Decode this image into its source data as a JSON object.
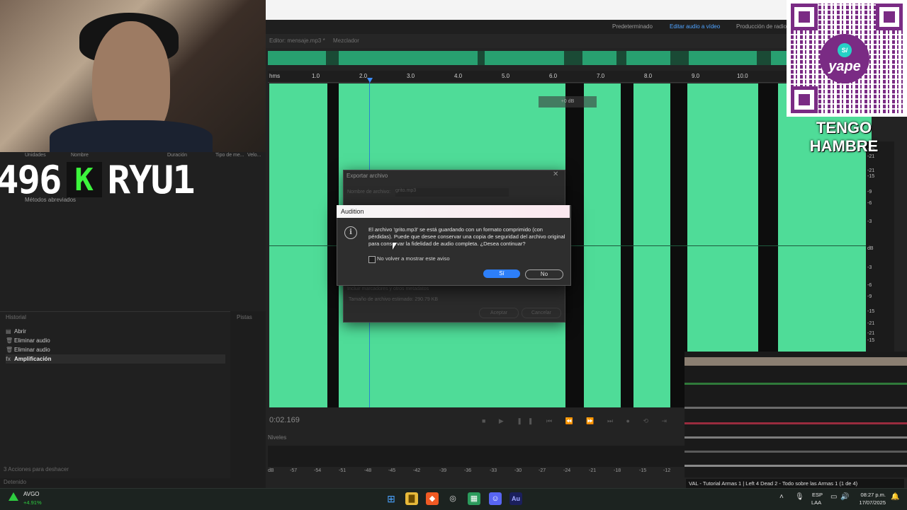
{
  "workspaces": {
    "items": [
      "Predeterminado",
      "Editar audio a vídeo",
      "Producción de radio"
    ],
    "active": "Editar audio a vídeo"
  },
  "editor": {
    "tab_file": "Editor: mensaje.mp3 *",
    "tab_mixer": "Mezclador",
    "ruler_unit": "hms",
    "ruler_ticks": [
      "1.0",
      "2.0",
      "3.0",
      "4.0",
      "5.0",
      "6.0",
      "7.0",
      "8.0",
      "9.0",
      "10.0"
    ],
    "gain_hud": "+0 dB",
    "db_ticks": [
      "-15",
      "-21",
      "-21",
      "-15",
      "-9",
      "-6",
      "-3",
      "dB",
      "-3",
      "-6",
      "-9",
      "-15",
      "-21",
      "-21",
      "-15"
    ],
    "timecode": "0:02.169",
    "levels_label": "Niveles",
    "meter_ticks": [
      "dB",
      "-57",
      "-54",
      "-51",
      "-48",
      "-45",
      "-42",
      "-39",
      "-36",
      "-33",
      "-30",
      "-27",
      "-24",
      "-21",
      "-18",
      "-15",
      "-12"
    ]
  },
  "files_panel": {
    "col_units": "Unidades",
    "col_name": "Nombre",
    "col_duration": "Duración",
    "col_type": "Tipo de me...",
    "col_rate": "Velo...",
    "shortcuts": "Métodos abreviados"
  },
  "stream_overlay": {
    "counter": "496",
    "badge": "K",
    "name": "RYU1",
    "donation_text": "TENGO HAMBRE",
    "yape_label": "yape",
    "yape_symbol": "S/"
  },
  "history": {
    "title": "Historial",
    "tools_title": "Pistas",
    "items": [
      {
        "label": "Abrir",
        "icon": "open-icon",
        "glyph": "▤",
        "selected": false
      },
      {
        "label": "Eliminar audio",
        "icon": "trash-icon",
        "glyph": "🗑",
        "selected": false
      },
      {
        "label": "Eliminar audio",
        "icon": "trash-icon",
        "glyph": "🗑",
        "selected": false
      },
      {
        "label": "Amplificación",
        "icon": "fx-icon",
        "glyph": "fx",
        "selected": true
      }
    ],
    "undo_count": "3 Acciones para deshacer",
    "status": "Detenido"
  },
  "export_dialog": {
    "title": "Exportar archivo",
    "name_label": "Nombre de archivo:",
    "name_value": "grito.mp3",
    "include_markers": "Incluir marcadores y otros metadatos",
    "estimated_size": "Tamaño de archivo estimado: 290.79 KB",
    "ok": "Aceptar",
    "cancel": "Cancelar"
  },
  "alert_dialog": {
    "title": "Audition",
    "message": "El archivo 'grito.mp3' se está guardando con un formato comprimido (con pérdidas). Puede que desee conservar una copia de seguridad del archivo original para conservar la fidelidad de audio completa. ¿Desea continuar?",
    "checkbox_label": "No volver a mostrar este aviso",
    "yes": "Sí",
    "no": "No"
  },
  "media": {
    "now_playing": "VAL - Tutorial Armas 1 | Left 4 Dead 2 - Todo sobre las Armas 1 (1 de 4)"
  },
  "taskbar": {
    "stock_name": "AVGO",
    "stock_change": "+4.91%",
    "lang_1": "ESP",
    "lang_2": "LAA",
    "time": "08:27 p.m.",
    "date": "17/07/2025"
  },
  "colors": {
    "waveform": "#4fdc98",
    "accent": "#2d7ff9",
    "yape": "#7a2b84",
    "stock_up": "#2ecc40"
  }
}
